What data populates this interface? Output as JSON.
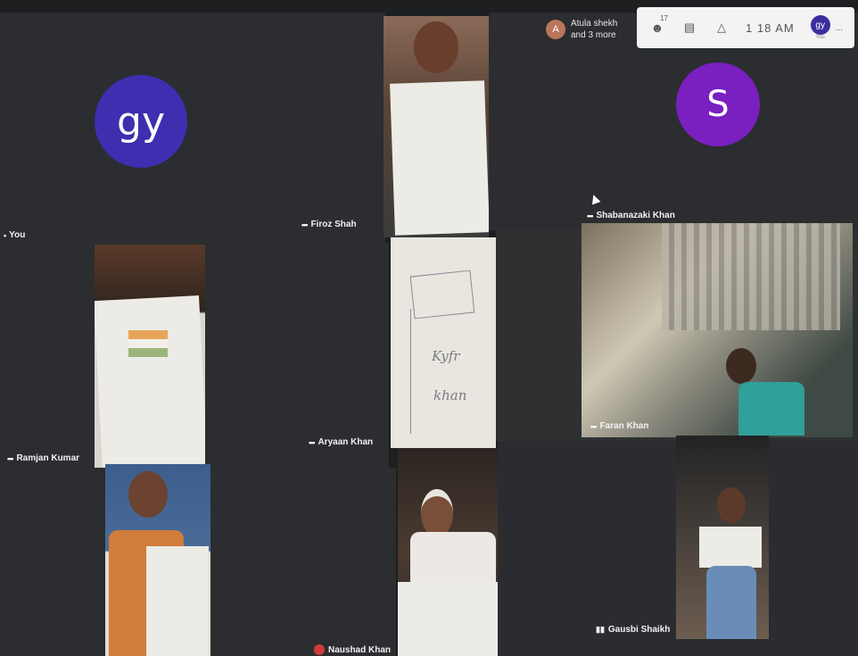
{
  "participants": {
    "you": "You",
    "firoz": "Firoz Shah",
    "shabana": "Shabanazaki Khan",
    "ramjan": "Ramjan Kumar",
    "aryaan": "Aryaan Khan",
    "faran": "Faran Khan",
    "naushad": "Naushad Khan",
    "gausbi": "Gausbi Shaikh"
  },
  "avatars": {
    "you_initials": "gy",
    "shabana_initial": "S"
  },
  "raised_hand": {
    "initial": "A",
    "line1": "Atula shekh",
    "line2": "and 3 more"
  },
  "toolbar": {
    "participants_count": "17",
    "time": "1 18 AM",
    "user_initials": "gy",
    "user_label": "You",
    "more": "..."
  },
  "drawing_text": {
    "line1": "Kyfr",
    "line2": "khan"
  },
  "colors": {
    "you_avatar": "#3d2fb0",
    "shabana_avatar": "#7a1fc0"
  }
}
